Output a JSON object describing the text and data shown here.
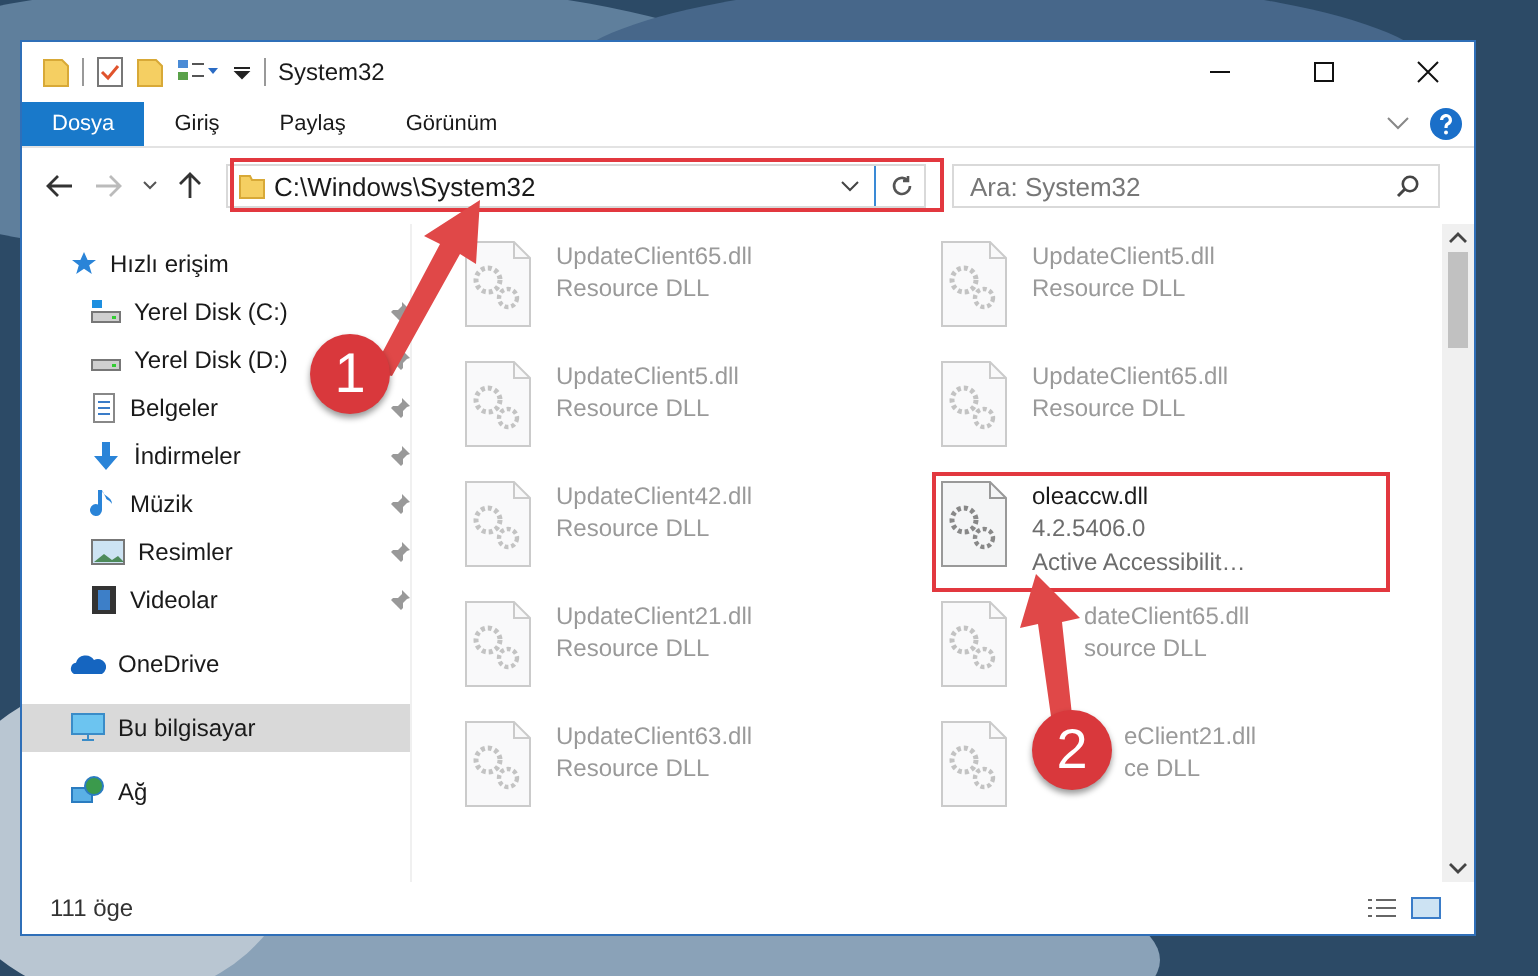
{
  "window": {
    "title": "System32"
  },
  "ribbon_tabs": [
    {
      "label": "Dosya",
      "selected": true
    },
    {
      "label": "Giriş",
      "selected": false
    },
    {
      "label": "Paylaş",
      "selected": false
    },
    {
      "label": "Görünüm",
      "selected": false
    }
  ],
  "address": {
    "value": "C:\\Windows\\System32"
  },
  "search": {
    "placeholder": "Ara: System32"
  },
  "nav": [
    {
      "label": "Hızlı erişim",
      "selected": false,
      "children": [
        {
          "label": "Yerel Disk (C:)",
          "pinned": true
        },
        {
          "label": "Yerel Disk (D:)",
          "pinned": true
        },
        {
          "label": "Belgeler",
          "pinned": true
        },
        {
          "label": "İndirmeler",
          "pinned": true
        },
        {
          "label": "Müzik",
          "pinned": true
        },
        {
          "label": "Resimler",
          "pinned": true
        },
        {
          "label": "Videolar",
          "pinned": true
        }
      ]
    },
    {
      "label": "OneDrive",
      "selected": false
    },
    {
      "label": "Bu bilgisayar",
      "selected": true
    },
    {
      "label": "Ağ",
      "selected": false
    }
  ],
  "files": [
    {
      "name": "UpdateClient65.dll",
      "lines": [
        "Resource DLL"
      ],
      "blurred": true
    },
    {
      "name": "UpdateClient5.dll",
      "lines": [
        "Resource DLL"
      ],
      "blurred": true
    },
    {
      "name": "UpdateClient5.dll",
      "lines": [
        "Resource DLL"
      ],
      "blurred": true
    },
    {
      "name": "UpdateClient65.dll",
      "lines": [
        "Resource DLL"
      ],
      "blurred": true
    },
    {
      "name": "UpdateClient42.dll",
      "lines": [
        "Resource DLL"
      ],
      "blurred": true
    },
    {
      "name": "oleaccw.dll",
      "lines": [
        "4.2.5406.0",
        "Active Accessibilit…"
      ],
      "blurred": false
    },
    {
      "name": "UpdateClient21.dll",
      "lines": [
        "Resource DLL"
      ],
      "blurred": true
    },
    {
      "name": "dateClient65.dll",
      "lines": [
        "source DLL"
      ],
      "blurred": true
    },
    {
      "name": "UpdateClient63.dll",
      "lines": [
        "Resource DLL"
      ],
      "blurred": true
    },
    {
      "name": "eClient21.dll",
      "lines": [
        "ce DLL"
      ],
      "blurred": true
    }
  ],
  "status_bar": {
    "count": "111 öge"
  },
  "annotations": [
    {
      "number": "1"
    },
    {
      "number": "2"
    }
  ]
}
